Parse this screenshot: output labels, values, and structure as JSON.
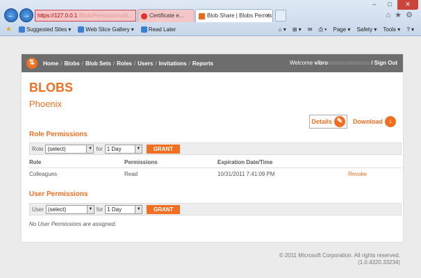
{
  "browser": {
    "address_url": "https://127.0.0.1",
    "address_rest": "/Blob/Permissions/b...",
    "tabs": [
      {
        "label": "Certificate e..."
      },
      {
        "label": "Blob Share | Blobs Permissi..."
      }
    ],
    "favorites": [
      "Suggested Sites",
      "Web Slice Gallery",
      "Read Later"
    ],
    "commands": [
      "Page",
      "Safety",
      "Tools"
    ]
  },
  "nav": {
    "links": [
      "Home",
      "Blobs",
      "Blob Sets",
      "Roles",
      "Users",
      "Invitations",
      "Reports"
    ],
    "separator": "/",
    "welcome_label": "Welcome",
    "welcome_user": "vibro",
    "welcome_blur": "xxxxxxxxxxxxxxx",
    "sign_out": "Sign Out"
  },
  "page": {
    "title": "BLOBS",
    "subtitle": "Phoenix",
    "details_label": "Details",
    "download_label": "Download"
  },
  "role_permissions": {
    "heading": "Role Permissions",
    "form": {
      "label": "Role",
      "select_value": "(select)",
      "for_label": "for",
      "duration": "1 Day",
      "grant_label": "GRANT"
    },
    "columns": [
      "Role",
      "Permissions",
      "Expiration Date/Time",
      ""
    ],
    "rows": [
      {
        "role": "Colleagues",
        "permissions": "Read",
        "expiration": "10/31/2011 7:41:09 PM",
        "action": "Revoke"
      }
    ]
  },
  "user_permissions": {
    "heading": "User Permissions",
    "form": {
      "label": "User",
      "select_value": "(select)",
      "for_label": "for",
      "duration": "1 Day",
      "grant_label": "GRANT"
    },
    "empty_message": "No User Permissions are assigned."
  },
  "footer": {
    "copyright": "© 2011 Microsoft Corporation. All rights reserved.",
    "version": "(1.0.4320.33234)"
  },
  "colors": {
    "accent": "#f26f21",
    "nav_bg": "#6d6d6d"
  }
}
